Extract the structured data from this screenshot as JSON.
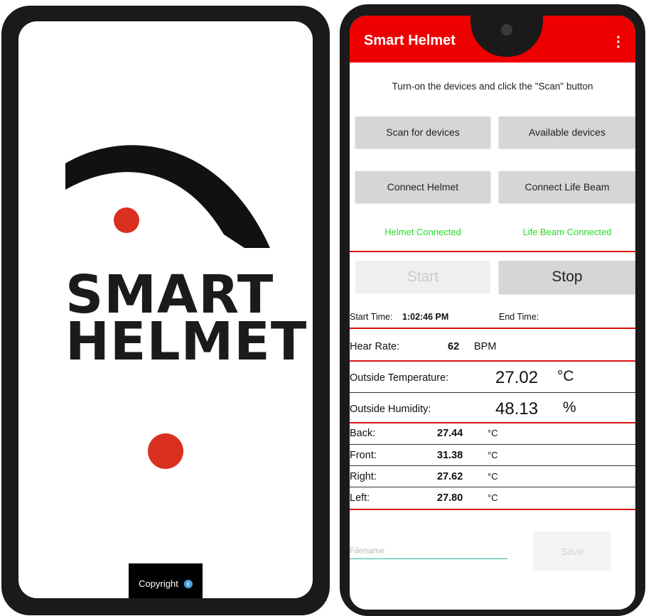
{
  "splash": {
    "logo_line1": "SMART",
    "logo_line2": "HELMET",
    "copyright_label": "Copyright",
    "info_icon": "i"
  },
  "app": {
    "title": "Smart Helmet",
    "menu_icon": "⋮",
    "instruction": "Turn-on the devices and click the \"Scan\" button",
    "buttons": {
      "scan": "Scan for devices",
      "available": "Available devices",
      "connect_helmet": "Connect Helmet",
      "connect_lifebeam": "Connect Life Beam",
      "start": "Start",
      "stop": "Stop",
      "save": "Save"
    },
    "status": {
      "helmet": "Helmet Connected",
      "lifebeam": "Life Beam Connected"
    },
    "time": {
      "start_label": "Start Time:",
      "start_value": "1:02:46 PM",
      "end_label": "End Time:"
    },
    "heart": {
      "label": "Hear Rate:",
      "value": "62",
      "unit": "BPM"
    },
    "outside_temp": {
      "label": "Outside Temperature:",
      "value": "27.02",
      "unit": "°C"
    },
    "outside_humidity": {
      "label": "Outside Humidity:",
      "value": "48.13",
      "unit": "%"
    },
    "sensors": [
      {
        "label": "Back:",
        "value": "27.44",
        "unit": "°C"
      },
      {
        "label": "Front:",
        "value": "31.38",
        "unit": "°C"
      },
      {
        "label": "Right:",
        "value": "27.62",
        "unit": "°C"
      },
      {
        "label": "Left:",
        "value": "27.80",
        "unit": "°C"
      }
    ],
    "filename_placeholder": "Filename"
  },
  "colors": {
    "appbar": "#ee0000",
    "status_green": "#22dd22",
    "divider_red": "#dd1111",
    "logo_dot": "#d9301f"
  }
}
